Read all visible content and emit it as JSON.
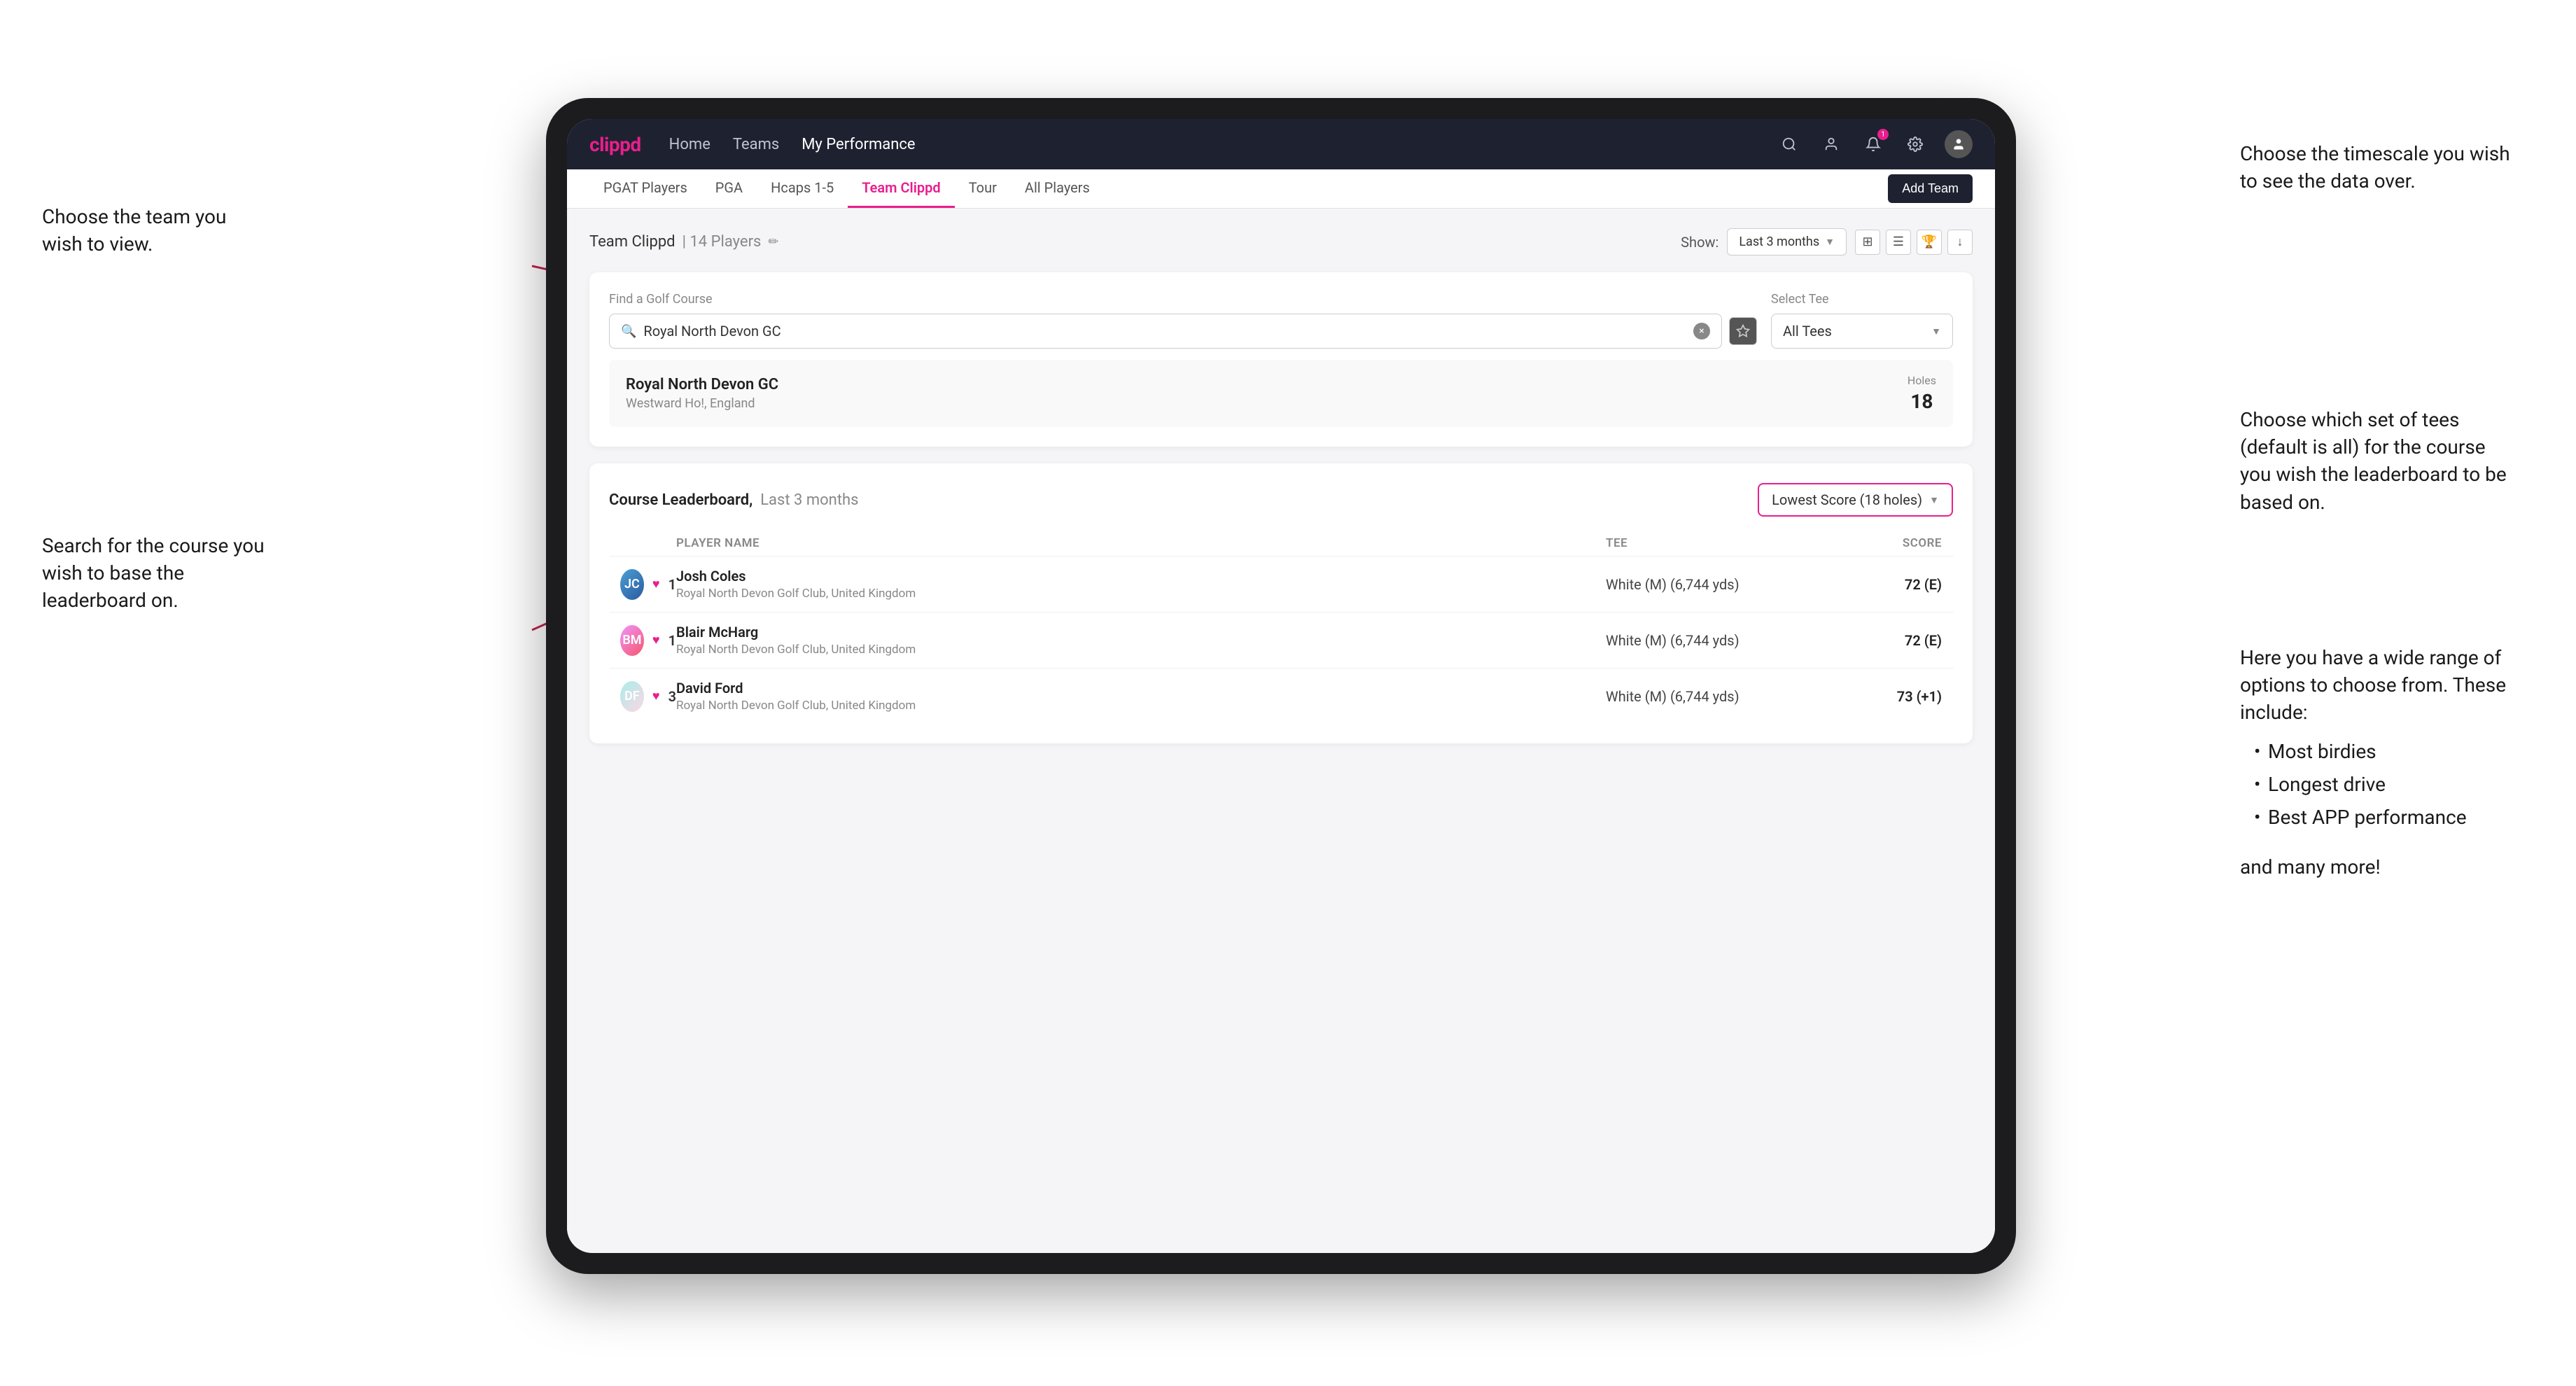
{
  "annotations": {
    "team_annotation": "Choose the team you\nwish to view.",
    "course_annotation": "Search for the course\nyou wish to base the\nleaderboard on.",
    "timescale_annotation": "Choose the timescale you\nwish to see the data over.",
    "tees_annotation": "Choose which set of tees\n(default is all) for the course\nyou wish the leaderboard to\nbe based on.",
    "options_annotation": "Here you have a wide range\nof options to choose from.\nThese include:",
    "options_list": [
      "Most birdies",
      "Longest drive",
      "Best APP performance"
    ],
    "and_more": "and many more!"
  },
  "nav": {
    "logo": "clippd",
    "links": [
      "Home",
      "Teams",
      "My Performance"
    ],
    "active_link": "My Performance",
    "icons": [
      "search",
      "person",
      "bell",
      "settings",
      "avatar"
    ]
  },
  "sub_nav": {
    "items": [
      "PGAT Players",
      "PGA",
      "Hcaps 1-5",
      "Team Clippd",
      "Tour",
      "All Players"
    ],
    "active": "Team Clippd",
    "add_button": "Add Team"
  },
  "team_header": {
    "title": "Team Clippd",
    "player_count": "14 Players",
    "show_label": "Show:",
    "timescale": "Last 3 months"
  },
  "course_search": {
    "find_label": "Find a Golf Course",
    "search_value": "Royal North Devon GC",
    "select_tee_label": "Select Tee",
    "tee_value": "All Tees"
  },
  "course_result": {
    "name": "Royal North Devon GC",
    "location": "Westward Ho!, England",
    "holes_label": "Holes",
    "holes_value": "18"
  },
  "leaderboard": {
    "title": "Course Leaderboard,",
    "subtitle": "Last 3 months",
    "score_type": "Lowest Score (18 holes)",
    "columns": {
      "player_name": "PLAYER NAME",
      "tee": "TEE",
      "score": "SCORE"
    },
    "players": [
      {
        "rank": "1",
        "name": "Josh Coles",
        "club": "Royal North Devon Golf Club, United Kingdom",
        "tee": "White (M) (6,744 yds)",
        "score": "72 (E)"
      },
      {
        "rank": "1",
        "name": "Blair McHarg",
        "club": "Royal North Devon Golf Club, United Kingdom",
        "tee": "White (M) (6,744 yds)",
        "score": "72 (E)"
      },
      {
        "rank": "3",
        "name": "David Ford",
        "club": "Royal North Devon Golf Club, United Kingdom",
        "tee": "White (M) (6,744 yds)",
        "score": "73 (+1)"
      }
    ]
  },
  "colors": {
    "brand_pink": "#e91e8c",
    "nav_dark": "#1e2130",
    "text_dark": "#222222",
    "text_muted": "#888888"
  }
}
